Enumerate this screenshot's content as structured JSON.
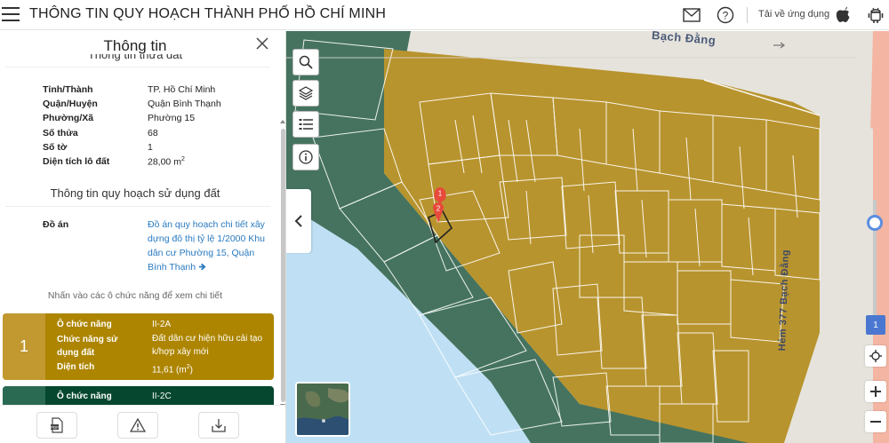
{
  "header": {
    "title": "THÔNG TIN QUY HOẠCH THÀNH PHỐ HỒ CHÍ MINH",
    "download_label": "Tải về ứng dụng",
    "icons": [
      "menu-icon",
      "mail-icon",
      "help-icon",
      "apple-icon",
      "android-icon"
    ]
  },
  "panel": {
    "title": "Thông tin",
    "cut_heading": "Thông tin thửa đất",
    "parcel_rows": [
      {
        "label": "Tỉnh/Thành",
        "value": "TP. Hồ Chí Minh"
      },
      {
        "label": "Quận/Huyện",
        "value": "Quận Bình Thạnh"
      },
      {
        "label": "Phường/Xã",
        "value": "Phường 15"
      },
      {
        "label": "Số thửa",
        "value": "68"
      },
      {
        "label": "Số tờ",
        "value": "1"
      },
      {
        "label": "Diện tích lô đất",
        "value": "28,00 m",
        "sup": "2"
      }
    ],
    "planning_title": "Thông tin quy hoạch sử dụng đất",
    "doan_label": "Đồ án",
    "doan_link": "Đồ án quy hoạch chi tiết xây dựng đô thị tỷ lệ 1/2000 Khu dân cư Phường 15, Quận Bình Thạnh",
    "hint": "Nhấn vào các ô chức năng để xem chi tiết",
    "zones": [
      {
        "number": "1",
        "color": "#ad8500",
        "func_label": "Ô chức năng",
        "func_value": "II-2A",
        "use_label": "Chức năng sử dụng đất",
        "use_value": "Đất dân cư hiện hữu cải tạo k/hợp xây mới",
        "area_label": "Diện tích",
        "area_value": "11,61 (m",
        "area_sup": "2",
        "area_close": ")"
      },
      {
        "number": "",
        "color": "#05472f",
        "func_label": "Ô chức năng",
        "func_value": "II-2C"
      }
    ]
  },
  "map": {
    "street_top": "Bạch Đằng",
    "street_right": "Hẻm 377 Bạch Đằng",
    "markers": [
      "1",
      "2"
    ],
    "zoom_level": "1",
    "colors": {
      "residential": "#b8942e",
      "green": "#45735f",
      "water": "#bfe0f4",
      "road": "#e6e3dc"
    }
  }
}
